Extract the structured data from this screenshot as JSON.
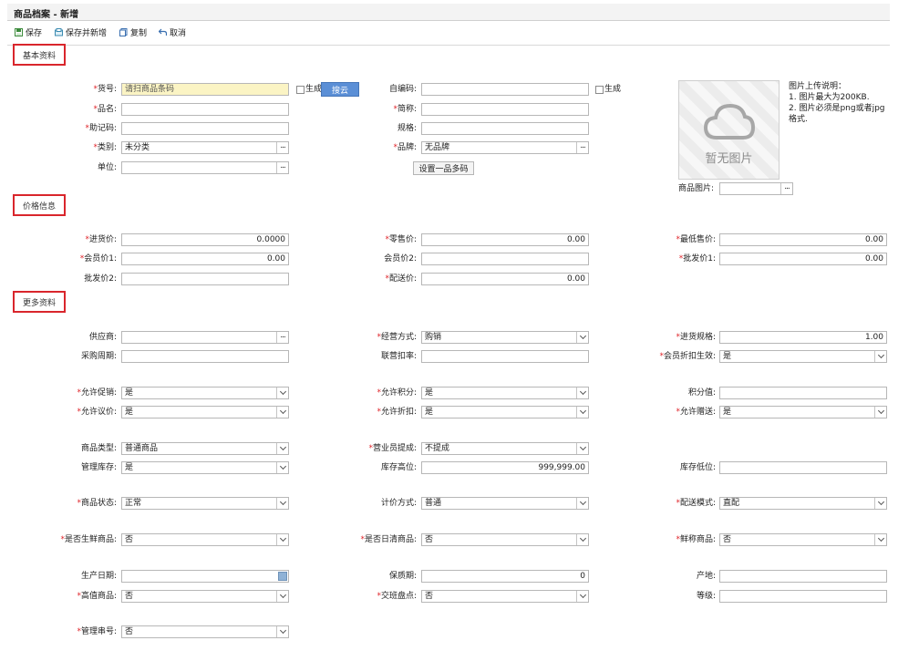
{
  "window": {
    "title": "商品档案 - 新增"
  },
  "toolbar": {
    "save": "保存",
    "save_new": "保存并新增",
    "copy": "复制",
    "cancel": "取消"
  },
  "sections": {
    "basic": "基本资料",
    "price": "价格信息",
    "more": "更多资料"
  },
  "basic": {
    "item_no": {
      "label": "货号:",
      "placeholder": "请扫商品条码",
      "generate": "生成",
      "search_btn": "搜云"
    },
    "self_code": {
      "label": "自编码:",
      "value": "",
      "generate": "生成"
    },
    "name": {
      "label": "品名:",
      "value": ""
    },
    "short_name": {
      "label": "简称:",
      "value": ""
    },
    "mnemonic": {
      "label": "助记码:",
      "value": ""
    },
    "spec": {
      "label": "规格:",
      "value": ""
    },
    "category": {
      "label": "类别:",
      "value": "未分类"
    },
    "brand": {
      "label": "品牌:",
      "value": "无品牌"
    },
    "unit": {
      "label": "单位:",
      "value": ""
    },
    "multi_code_btn": "设置一品多码",
    "image_placeholder": "暂无图片",
    "image_label": "商品图片:",
    "image_note": {
      "title": "图片上传说明：",
      "line1": "1. 图片最大为200KB.",
      "line2": "2. 图片必须是png或者jpg格式."
    }
  },
  "price": {
    "purchase": {
      "label": "进货价:",
      "value": "0.0000"
    },
    "retail": {
      "label": "零售价:",
      "value": "0.00"
    },
    "min_sale": {
      "label": "最低售价:",
      "value": "0.00"
    },
    "member1": {
      "label": "会员价1:",
      "value": "0.00"
    },
    "member2": {
      "label": "会员价2:",
      "value": ""
    },
    "wholesale1": {
      "label": "批发价1:",
      "value": "0.00"
    },
    "wholesale2": {
      "label": "批发价2:",
      "value": ""
    },
    "delivery": {
      "label": "配送价:",
      "value": "0.00"
    }
  },
  "more": {
    "supplier": {
      "label": "供应商:",
      "value": ""
    },
    "biz_mode": {
      "label": "经营方式:",
      "value": "购销"
    },
    "purchase_spec": {
      "label": "进货规格:",
      "value": "1.00"
    },
    "purchase_cycle": {
      "label": "采购周期:",
      "value": ""
    },
    "joint_deduct": {
      "label": "联营扣率:",
      "value": ""
    },
    "member_discount": {
      "label": "会员折扣生效:",
      "value": "是"
    },
    "allow_promo": {
      "label": "允许促销:",
      "value": "是"
    },
    "allow_points": {
      "label": "允许积分:",
      "value": "是"
    },
    "points_value": {
      "label": "积分值:",
      "value": ""
    },
    "allow_bargain": {
      "label": "允许议价:",
      "value": "是"
    },
    "allow_discount": {
      "label": "允许折扣:",
      "value": "是"
    },
    "allow_gift": {
      "label": "允许赠送:",
      "value": "是"
    },
    "item_type": {
      "label": "商品类型:",
      "value": "普通商品"
    },
    "sales_commission": {
      "label": "营业员提成:",
      "value": "不提成"
    },
    "manage_stock": {
      "label": "管理库存:",
      "value": "是"
    },
    "stock_high": {
      "label": "库存高位:",
      "value": "999,999.00"
    },
    "stock_low": {
      "label": "库存低位:",
      "value": ""
    },
    "item_status": {
      "label": "商品状态:",
      "value": "正常"
    },
    "pricing_mode": {
      "label": "计价方式:",
      "value": "普通"
    },
    "delivery_mode": {
      "label": "配送模式:",
      "value": "直配"
    },
    "is_fresh": {
      "label": "是否生鲜商品:",
      "value": "否"
    },
    "is_daily_clear": {
      "label": "是否日清商品:",
      "value": "否"
    },
    "perishable": {
      "label": "鲜称商品:",
      "value": "否"
    },
    "prod_date": {
      "label": "生产日期:",
      "value": ""
    },
    "shelf_life": {
      "label": "保质期:",
      "value": "0"
    },
    "origin": {
      "label": "产地:",
      "value": ""
    },
    "high_value": {
      "label": "高值商品:",
      "value": "否"
    },
    "shift_check": {
      "label": "交班盘点:",
      "value": "否"
    },
    "grade": {
      "label": "等级:",
      "value": ""
    },
    "serial_mgmt": {
      "label": "管理串号:",
      "value": "否"
    }
  },
  "colors": {
    "required": "#e0242a",
    "section_border": "#d9262c",
    "accent_button": "#5b8fd6",
    "highlight_input": "#fbf4c4"
  },
  "icons": {
    "save": "save-icon",
    "save_new": "save-new-icon",
    "copy": "copy-icon",
    "cancel": "undo-icon",
    "dropdown": "chevron-down-icon",
    "picker": "ellipsis-icon",
    "calendar": "calendar-icon"
  }
}
